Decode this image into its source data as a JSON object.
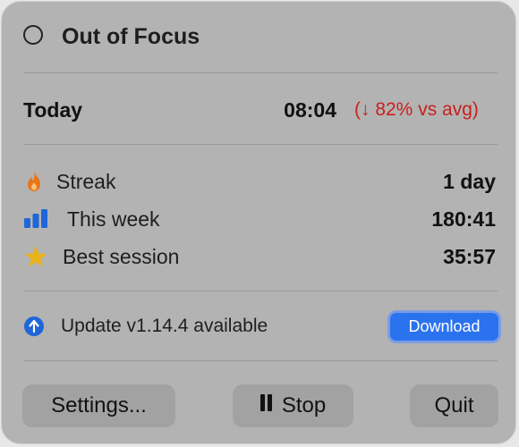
{
  "header": {
    "title": "Out of Focus",
    "icon": "circle-outline-icon"
  },
  "today": {
    "label": "Today",
    "time": "08:04",
    "delta": "(↓ 82% vs avg)"
  },
  "stats": [
    {
      "icon": "flame-icon",
      "label": "Streak",
      "value": "1 day"
    },
    {
      "icon": "bar-chart-icon",
      "label": "This week",
      "value": "180:41"
    },
    {
      "icon": "star-icon",
      "label": "Best session",
      "value": "35:57"
    }
  ],
  "update": {
    "icon": "arrow-up-circle-icon",
    "text": "Update v1.14.4 available",
    "button_label": "Download"
  },
  "footer": {
    "settings_label": "Settings...",
    "stop_label": "Stop",
    "quit_label": "Quit"
  },
  "colors": {
    "panel_bg": "#b3b3b3",
    "accent_blue": "#2b72ee",
    "delta_red": "#c9201d",
    "flame_orange": "#e8761c",
    "star_gold": "#e8b21a",
    "chart_blue": "#1f66d8"
  }
}
